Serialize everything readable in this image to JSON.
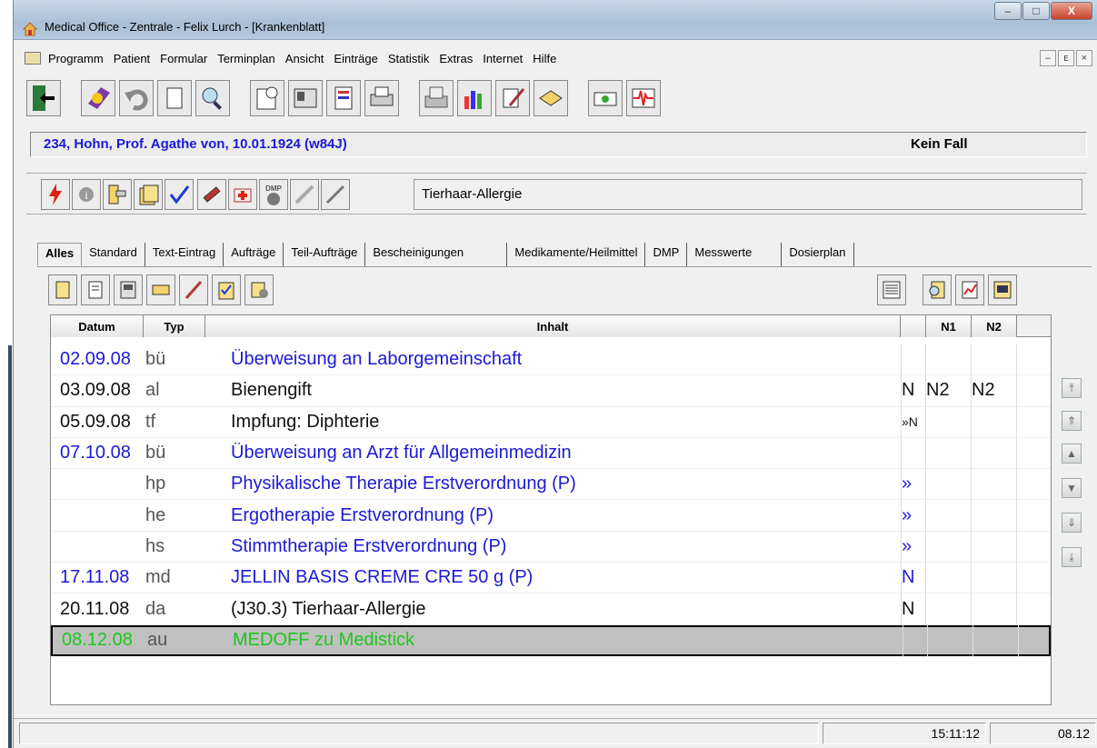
{
  "window": {
    "title": "Medical Office - Zentrale - Felix Lurch - [Krankenblatt]",
    "buttons": {
      "minimize": "–",
      "maximize": "□",
      "close": "X"
    }
  },
  "menu": {
    "items": [
      "Programm",
      "Patient",
      "Formular",
      "Terminplan",
      "Ansicht",
      "Einträge",
      "Statistik",
      "Extras",
      "Internet",
      "Hilfe"
    ],
    "mdi": {
      "minimize": "–",
      "restore": "ᴇ",
      "close": "×"
    }
  },
  "patient": {
    "info": "234, Hohn, Prof. Agathe von, 10.01.1924 (w84J)",
    "case_status": "Kein Fall"
  },
  "allergy": {
    "text": "Tierhaar-Allergie",
    "dmp_icon_label": "DMP"
  },
  "tabs": [
    "Alles",
    "Standard",
    "Text-Eintrag",
    "Aufträge",
    "Teil-Aufträge",
    "Bescheinigungen",
    "Medikamente/Heilmittel",
    "DMP",
    "Messwerte",
    "Dosierplan"
  ],
  "grid": {
    "headers": {
      "datum": "Datum",
      "typ": "Typ",
      "inhalt": "Inhalt",
      "n1": "N1",
      "n2": "N2"
    },
    "rows": [
      {
        "datum": "02.09.08",
        "typ": "bü",
        "inhalt": "Überweisung an Laborgemeinschaft",
        "flag": "",
        "n1": "",
        "n2": ""
      },
      {
        "datum": "03.09.08",
        "typ": "al",
        "inhalt": "Bienengift",
        "flag": "N",
        "n1": "N2",
        "n2": "N2"
      },
      {
        "datum": "05.09.08",
        "typ": "tf",
        "inhalt": "Impfung: Diphterie",
        "flag": "»N",
        "n1": "",
        "n2": ""
      },
      {
        "datum": "07.10.08",
        "typ": "bü",
        "inhalt": "Überweisung an Arzt für Allgemeinmedizin",
        "flag": "",
        "n1": "",
        "n2": ""
      },
      {
        "datum": "",
        "typ": "hp",
        "inhalt": "Physikalische Therapie Erstverordnung (P)",
        "flag": "»",
        "n1": "",
        "n2": ""
      },
      {
        "datum": "",
        "typ": "he",
        "inhalt": "Ergotherapie Erstverordnung (P)",
        "flag": "»",
        "n1": "",
        "n2": ""
      },
      {
        "datum": "",
        "typ": "hs",
        "inhalt": "Stimmtherapie Erstverordnung (P)",
        "flag": "»",
        "n1": "",
        "n2": ""
      },
      {
        "datum": "17.11.08",
        "typ": "md",
        "inhalt": "JELLIN BASIS CREME CRE 50 g (P)",
        "flag": "N",
        "n1": "",
        "n2": ""
      },
      {
        "datum": "20.11.08",
        "typ": "da",
        "inhalt": "(J30.3) Tierhaar-Allergie",
        "flag": "N",
        "n1": "",
        "n2": ""
      },
      {
        "datum": "08.12.08",
        "typ": "au",
        "inhalt": "MEDOFF zu Medistick",
        "flag": "",
        "n1": "",
        "n2": ""
      }
    ]
  },
  "status": {
    "time": "15:11:12",
    "date": "08.12"
  },
  "colors": {
    "blue_text": "#1a1ad6",
    "green_text": "#1ac81a",
    "selected_row": "#c0c0c0"
  }
}
